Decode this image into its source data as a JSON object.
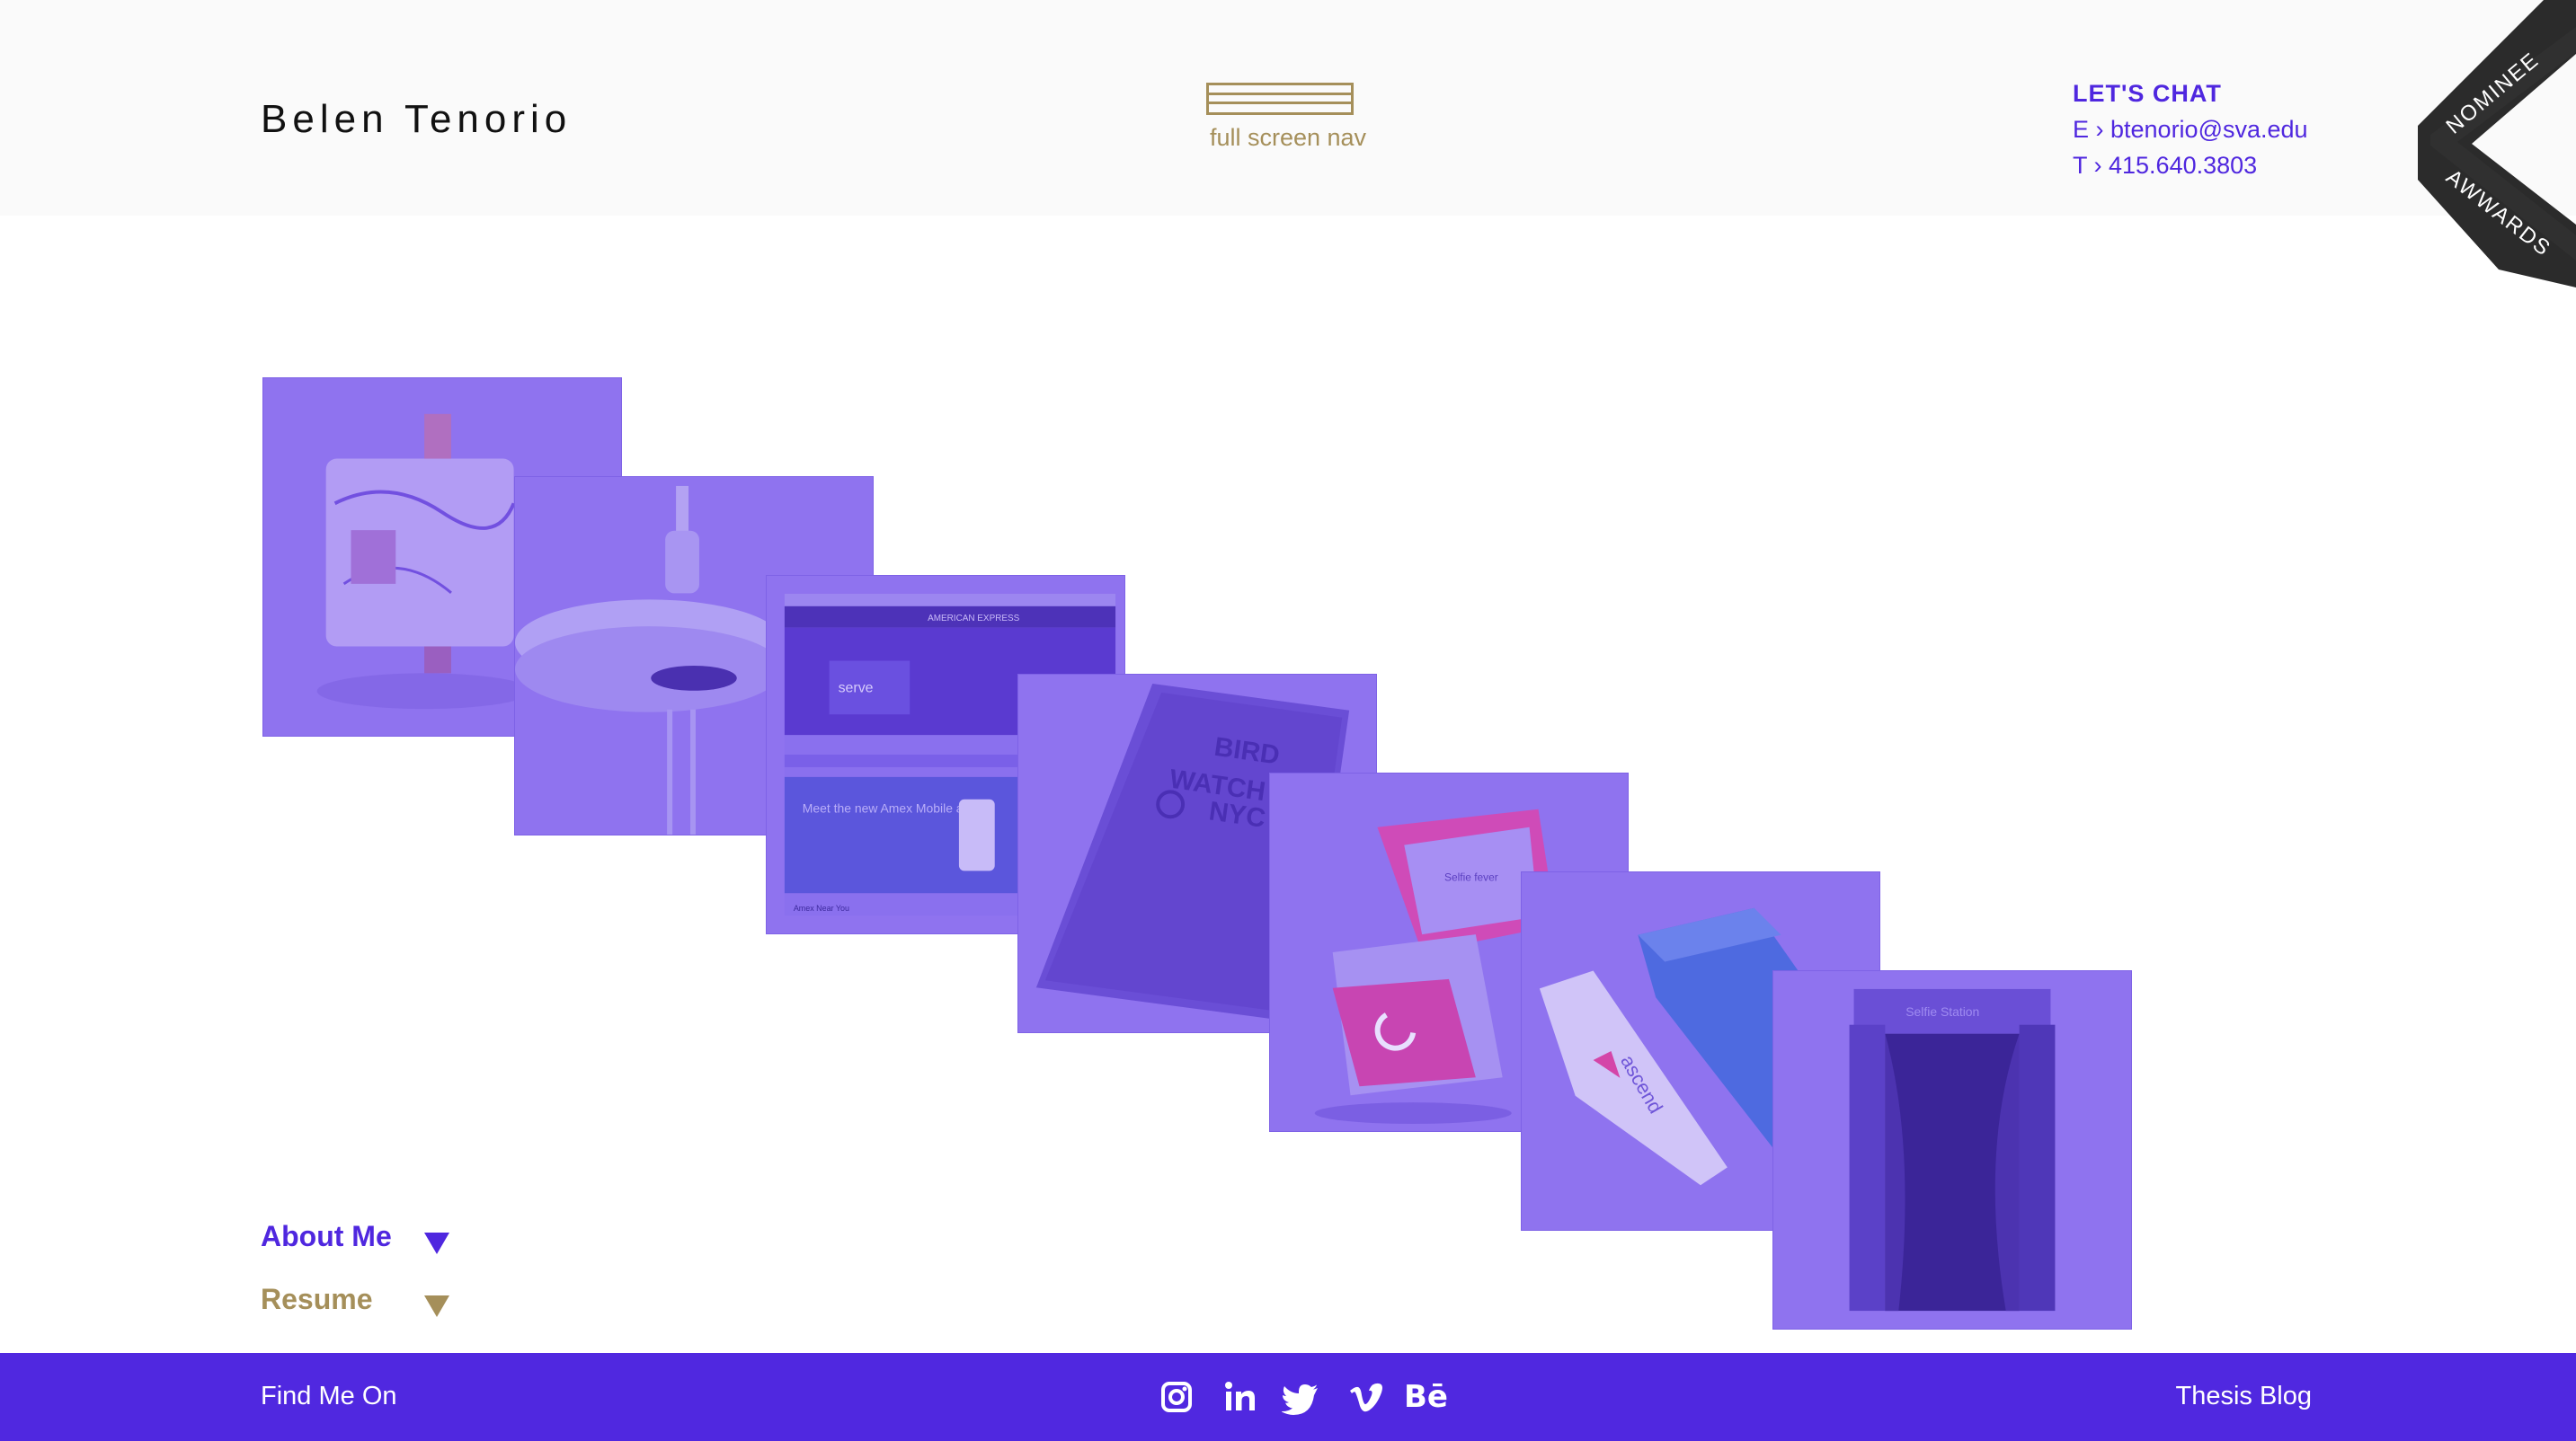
{
  "header": {
    "brand": "Belen Tenorio",
    "menu_label": "full screen nav",
    "contact": {
      "title": "LET'S CHAT",
      "email": "E › btenorio@sva.edu",
      "phone": "T › 415.640.3803"
    },
    "award": {
      "top": "NOMINEE",
      "bottom": "AWWARDS"
    }
  },
  "gallery": {
    "tiles": [
      {
        "name": "tile-marble-speaker",
        "icon": "marble-cube-image"
      },
      {
        "name": "tile-faucet",
        "icon": "faucet-image"
      },
      {
        "name": "tile-amex-web",
        "icon": "website-mockup-image",
        "text_heading": "AMERICAN EXPRESS",
        "text_hero": "serve",
        "text_sub": "Meet the new Amex Mobile app",
        "text_footer": "Amex Near You"
      },
      {
        "name": "tile-bird-watch",
        "icon": "book-image",
        "text": [
          "BIRD",
          "WATCH",
          "NYC"
        ]
      },
      {
        "name": "tile-box-packaging",
        "icon": "packaging-box-image",
        "text": "Selfie fever"
      },
      {
        "name": "tile-ascend",
        "icon": "tube-packaging-image",
        "text": "ascend"
      },
      {
        "name": "tile-booth",
        "icon": "photo-booth-image",
        "text": "Selfie Station"
      }
    ]
  },
  "subnav": {
    "about": "About Me",
    "resume": "Resume"
  },
  "footer": {
    "find": "Find Me On",
    "social": [
      "instagram",
      "linkedin",
      "twitter",
      "vimeo",
      "behance"
    ],
    "behance_label": "Bē",
    "blog": "Thesis Blog"
  },
  "colors": {
    "accent": "#5028e0",
    "gold": "#a58f5a",
    "tile": "#8f73ef"
  }
}
